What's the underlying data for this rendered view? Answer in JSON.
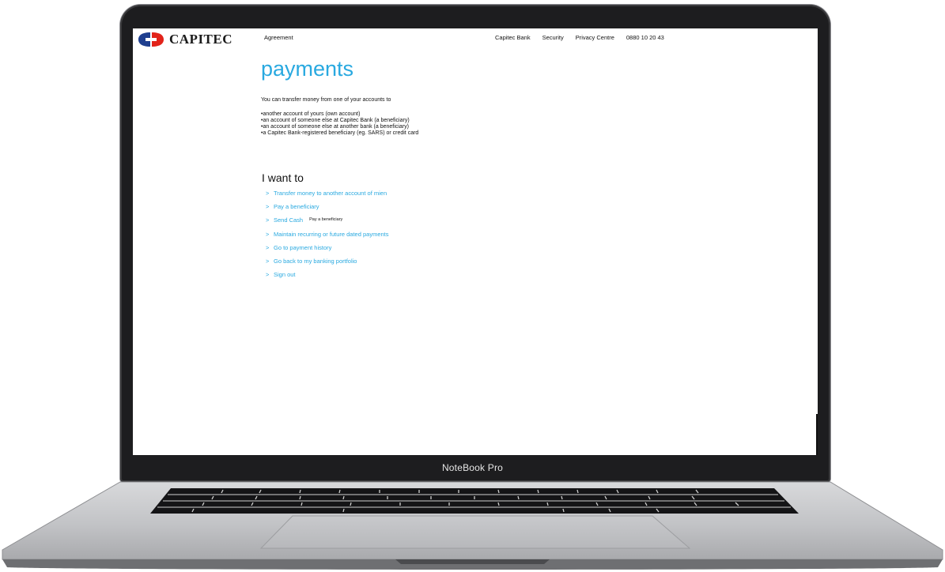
{
  "device": {
    "label": "NoteBook Pro"
  },
  "header": {
    "logo_text": "CAPITEC",
    "agreement": "Agreement",
    "nav": [
      "Capitec Bank",
      "Security",
      "Privacy Centre",
      "0880 10 20 43"
    ]
  },
  "main": {
    "title": "payments",
    "intro": "You can transfer money from one of your accounts to",
    "bullets": [
      "another account of yours (own account)",
      "an account of someone else at Capitec Bank (a beneficiary)",
      "an account of someone else at another bank (a beneficiary)",
      "a Capitec Bank-registered beneficiary (eg. SARS) or credit card"
    ],
    "iwant_heading": "I want to",
    "arrow": ">",
    "links": [
      "Transfer money to another account of mien",
      "Pay a beneficiary",
      "Send Cash",
      "Maintain recurring or future dated payments",
      "Go to payment history",
      "Go back to my banking portfolio",
      "Sign out"
    ],
    "tooltip": "Pay a beneficiary"
  },
  "colors": {
    "accent": "#29a9e0",
    "logo_red": "#e2231a",
    "logo_blue": "#1f3f8f"
  }
}
